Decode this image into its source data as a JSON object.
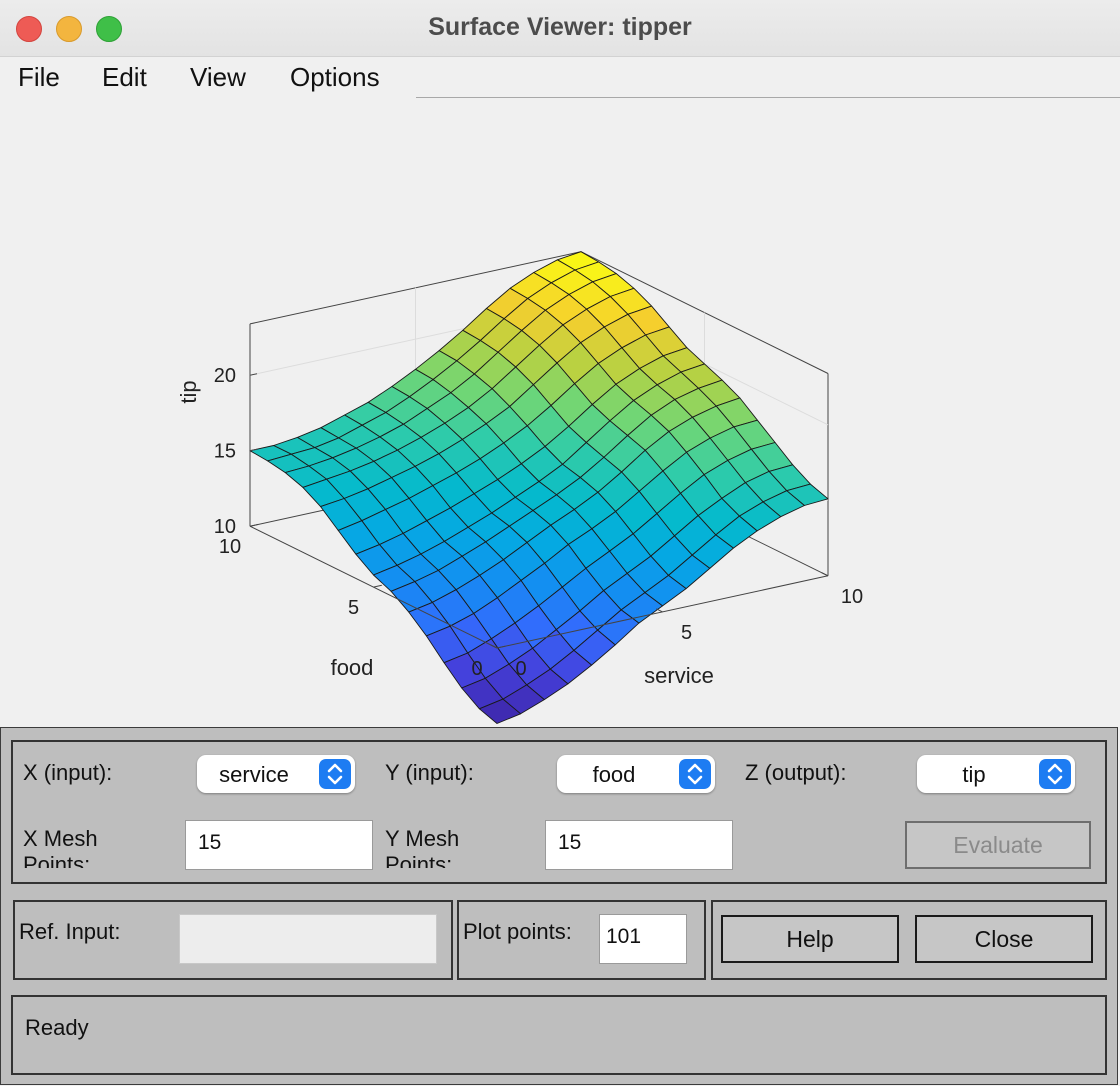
{
  "window": {
    "title": "Surface Viewer: tipper"
  },
  "menu": [
    "File",
    "Edit",
    "View",
    "Options"
  ],
  "colors": {
    "close": "#ee5b55",
    "minimize": "#f3b53f",
    "zoom": "#3fbf48",
    "select_accent": "#1d7cf2"
  },
  "chart_data": {
    "type": "surface",
    "xlabel": "service",
    "ylabel": "food",
    "zlabel": "tip",
    "xlim": [
      0,
      10
    ],
    "ylim": [
      0,
      10
    ],
    "x_ticks": [
      "0",
      "5",
      "10"
    ],
    "y_ticks": [
      "0",
      "5",
      "10"
    ],
    "z_ticks": [
      "10",
      "15",
      "20"
    ],
    "colormap": "parula",
    "grid": true,
    "mesh_points": 15,
    "x": [
      0,
      0.714,
      1.429,
      2.143,
      2.857,
      3.571,
      4.286,
      5,
      5.714,
      6.429,
      7.143,
      7.857,
      8.571,
      9.286,
      10
    ],
    "y": [
      0,
      0.714,
      1.429,
      2.143,
      2.857,
      3.571,
      4.286,
      5,
      5.714,
      6.429,
      7.143,
      7.857,
      8.571,
      9.286,
      10
    ],
    "z_rows": [
      [
        5.0,
        5.3,
        5.9,
        6.6,
        7.5,
        8.5,
        9.6,
        10.4,
        11.2,
        12.2,
        13.2,
        14.0,
        14.6,
        15.0,
        15.1
      ],
      [
        5.4,
        5.7,
        6.3,
        7.0,
        7.9,
        8.9,
        9.9,
        10.7,
        11.5,
        12.5,
        13.5,
        14.4,
        15.0,
        15.4,
        15.5
      ],
      [
        6.2,
        6.5,
        7.1,
        7.8,
        8.7,
        9.6,
        10.6,
        11.4,
        12.2,
        13.2,
        14.2,
        15.0,
        15.7,
        16.1,
        16.2
      ],
      [
        7.3,
        7.6,
        8.2,
        8.9,
        9.7,
        10.6,
        11.5,
        12.3,
        13.1,
        14.1,
        15.1,
        16.0,
        16.6,
        17.0,
        17.1
      ],
      [
        8.5,
        8.8,
        9.3,
        10.0,
        10.8,
        11.6,
        12.5,
        13.2,
        14.0,
        15.0,
        16.0,
        16.9,
        17.5,
        17.9,
        18.0
      ],
      [
        9.5,
        9.8,
        10.3,
        10.9,
        11.6,
        12.4,
        13.2,
        13.9,
        14.7,
        15.7,
        16.8,
        17.7,
        18.3,
        18.7,
        18.9
      ],
      [
        10.3,
        10.6,
        11.0,
        11.6,
        12.2,
        12.9,
        13.6,
        14.3,
        15.1,
        16.1,
        17.2,
        18.2,
        18.9,
        19.3,
        19.5
      ],
      [
        10.8,
        11.1,
        11.5,
        12.0,
        12.6,
        13.2,
        13.9,
        14.6,
        15.4,
        16.5,
        17.6,
        18.6,
        19.3,
        19.8,
        20.0
      ],
      [
        11.6,
        11.9,
        12.3,
        12.8,
        13.3,
        13.9,
        14.5,
        15.2,
        16.0,
        17.0,
        18.1,
        19.1,
        19.8,
        20.3,
        20.5
      ],
      [
        12.6,
        12.9,
        13.3,
        13.7,
        14.2,
        14.7,
        15.3,
        16.0,
        16.8,
        17.8,
        18.9,
        19.9,
        20.6,
        21.1,
        21.3
      ],
      [
        13.6,
        13.8,
        14.1,
        14.5,
        14.9,
        15.4,
        16.0,
        16.7,
        17.5,
        18.6,
        19.7,
        20.7,
        21.4,
        21.9,
        22.1
      ],
      [
        14.3,
        14.5,
        14.7,
        15.0,
        15.4,
        15.9,
        16.5,
        17.2,
        18.1,
        19.2,
        20.3,
        21.3,
        22.0,
        22.5,
        22.7
      ],
      [
        14.7,
        14.8,
        15.0,
        15.3,
        15.7,
        16.2,
        16.9,
        17.6,
        18.5,
        19.6,
        20.7,
        21.7,
        22.4,
        22.9,
        23.1
      ],
      [
        14.9,
        15.0,
        15.1,
        15.4,
        15.9,
        16.4,
        17.1,
        17.9,
        18.8,
        19.8,
        20.9,
        21.9,
        22.6,
        23.1,
        23.3
      ],
      [
        15.0,
        15.0,
        15.2,
        15.5,
        16.0,
        16.5,
        17.2,
        18.0,
        18.9,
        19.9,
        21.0,
        22.0,
        22.7,
        23.2,
        23.4
      ]
    ]
  },
  "controls": {
    "x_input_label": "X (input):",
    "x_input_value": "service",
    "y_input_label": "Y (input):",
    "y_input_value": "food",
    "z_output_label": "Z (output):",
    "z_output_value": "tip",
    "x_mesh_label": "X Mesh Points:",
    "x_mesh_value": "15",
    "y_mesh_label": "Y Mesh Points:",
    "y_mesh_value": "15",
    "evaluate_label": "Evaluate",
    "ref_input_label": "Ref. Input:",
    "ref_input_value": "",
    "plot_points_label": "Plot points:",
    "plot_points_value": "101",
    "help_label": "Help",
    "close_label": "Close"
  },
  "status": {
    "text": "Ready"
  }
}
